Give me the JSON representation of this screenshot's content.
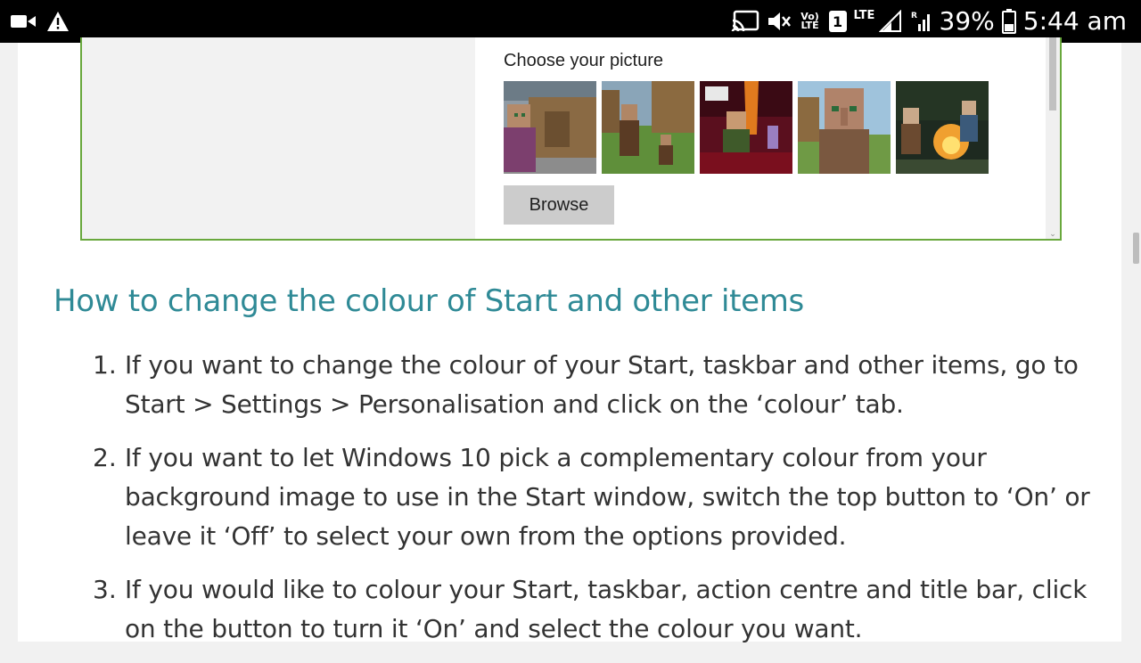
{
  "status_bar": {
    "battery_percent": "39%",
    "time": "5:44 am",
    "lte_label": "LTE",
    "volte_label": "Vo) LTE",
    "sim_label": "1",
    "icons": [
      "video-camera-icon",
      "warning-icon",
      "cast-icon",
      "mute-icon",
      "volte-icon",
      "sim-icon",
      "lte-signal-icon",
      "roaming-signal-icon",
      "battery-icon"
    ]
  },
  "screenshot": {
    "choose_label": "Choose your picture",
    "browse_label": "Browse",
    "thumbnails": [
      "minecraft-villager-house-image",
      "minecraft-villagers-field-image",
      "minecraft-warrior-image",
      "minecraft-villager-closeup-image",
      "minecraft-campfire-image"
    ]
  },
  "article": {
    "heading": "How to change the colour of Start and other items",
    "steps": [
      {
        "number": "1.",
        "text": "If you want to change the colour of your Start, taskbar and other items, go to Start > Settings > Personalisation and click on the ‘colour’ tab."
      },
      {
        "number": "2.",
        "text": "If you want to let Windows 10 pick a complementary colour from your background image to use in the Start window, switch the top button to ‘On’ or leave it ‘Off’ to select your own from the options provided."
      },
      {
        "number": "3.",
        "text": "If you would like to colour your Start, taskbar, action centre and title bar, click on the button to turn it ‘On’ and select the colour you want."
      }
    ]
  },
  "colors": {
    "heading": "#2f8a96",
    "frame_border": "#69a83d",
    "status_bar": "#000000"
  }
}
